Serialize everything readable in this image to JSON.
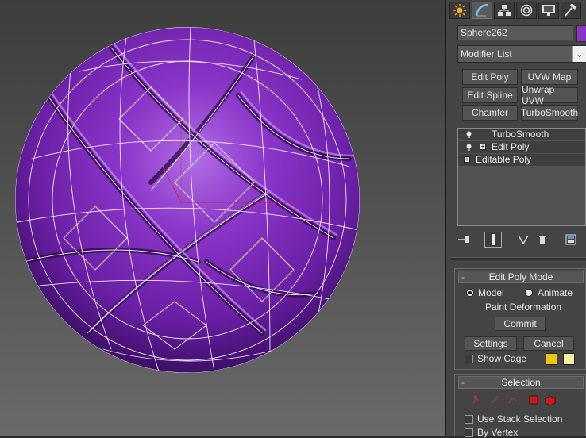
{
  "command_panel": {
    "tabs": [
      {
        "name": "create-tab",
        "icon": "sun-icon"
      },
      {
        "name": "modify-tab",
        "icon": "modify-arc-icon"
      },
      {
        "name": "hierarchy-tab",
        "icon": "hierarchy-icon"
      },
      {
        "name": "motion-tab",
        "icon": "motion-circle-icon"
      },
      {
        "name": "display-tab",
        "icon": "monitor-icon"
      },
      {
        "name": "utilities-tab",
        "icon": "hammer-icon"
      }
    ],
    "object_name": "Sphere262",
    "object_color": "#8a35c8",
    "modifier_list": "Modifier List",
    "modifier_buttons": [
      "Edit Poly",
      "UVW Map",
      "Edit Spline",
      "Unwrap UVW",
      "Chamfer",
      "TurboSmooth"
    ],
    "stack": [
      {
        "label": "TurboSmooth"
      },
      {
        "label": "Edit Poly"
      },
      {
        "label": "Editable Poly"
      }
    ]
  },
  "edit_poly_mode": {
    "title": "Edit Poly Mode",
    "model_label": "Model",
    "animate_label": "Animate",
    "paint_deformation": "Paint Deformation",
    "commit_label": "Commit",
    "settings_label": "Settings",
    "cancel_label": "Cancel",
    "show_cage_label": "Show Cage",
    "cage_color_1": "#f1c40f",
    "cage_color_2": "#f3f0a0"
  },
  "selection": {
    "title": "Selection",
    "use_stack_selection": "Use Stack Selection",
    "by_vertex": "By Vertex"
  },
  "colors": {
    "object": "#8a35c8",
    "panel_bg": "#444444"
  }
}
